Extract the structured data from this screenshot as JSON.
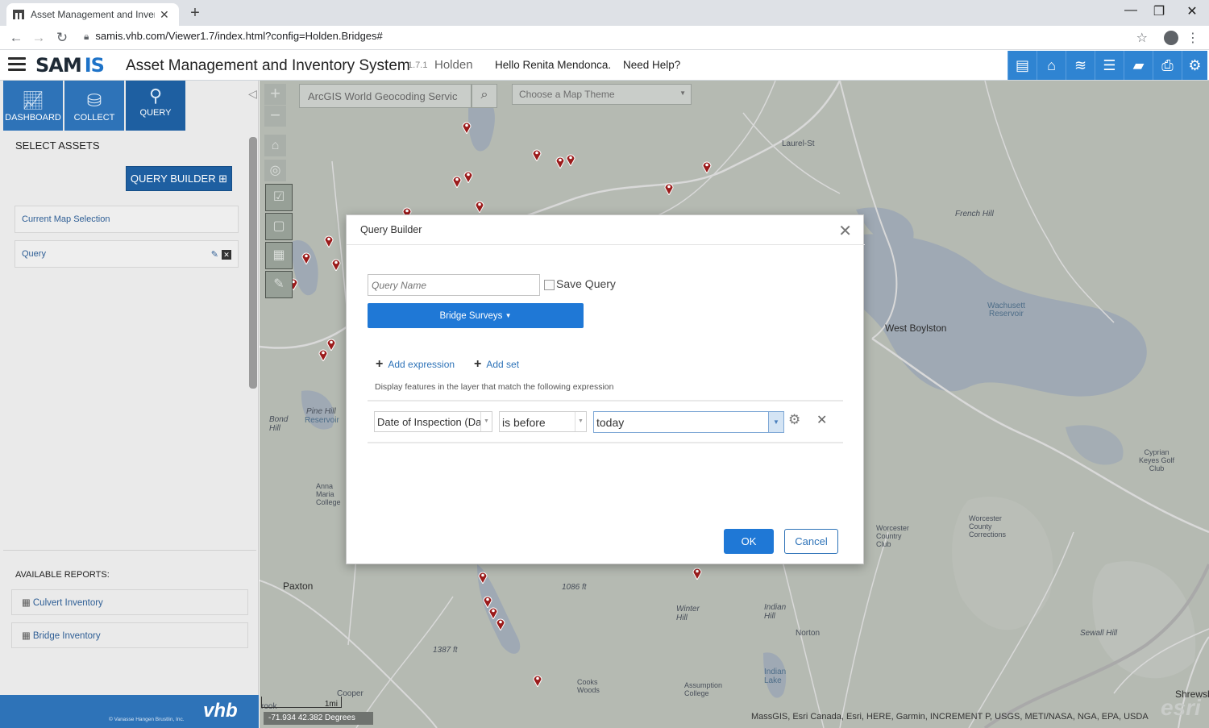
{
  "browser": {
    "tab_title": "Asset Management and Inventor",
    "new_tab_icon": "plus-icon",
    "url": "samis.vhb.com/Viewer1.7/index.html?config=Holden.Bridges#",
    "window_controls": [
      "minimize",
      "restore",
      "close"
    ]
  },
  "header": {
    "logo_sam": "SAM",
    "logo_is": "IS",
    "title": "Asset Management and Inventory System",
    "version": "1.7.1",
    "town": "Holden",
    "greeting": "Hello Renita Mendonca.",
    "help": "Need Help?",
    "toolbar_icons": [
      "report-icon",
      "home-icon",
      "layers-icon",
      "list-icon",
      "graduation-cap-icon",
      "print-icon",
      "gear-icon"
    ],
    "accent": "#2f84d2"
  },
  "left_panel": {
    "modes": [
      {
        "label": "DASHBOARD",
        "icon": "chart-icon"
      },
      {
        "label": "COLLECT",
        "icon": "database-icon"
      },
      {
        "label": "QUERY",
        "icon": "binoculars-icon"
      }
    ],
    "section_title": "SELECT ASSETS",
    "query_builder_button": "QUERY BUILDER",
    "items": [
      {
        "label": "Current Map Selection"
      },
      {
        "label": "Query"
      }
    ],
    "reports_title": "AVAILABLE REPORTS:",
    "reports": [
      {
        "label": "Culvert Inventory"
      },
      {
        "label": "Bridge Inventory"
      }
    ],
    "footer_copyright": "© Vanasse Hangen Brustlin, Inc.",
    "footer_logo": "vhb",
    "brand_color": "#2e73b8"
  },
  "map": {
    "search_placeholder": "ArcGIS World Geocoding Servic",
    "theme_placeholder": "Choose a Map Theme",
    "coordinates": "-71.934 42.382 Degrees",
    "scale_label": "1mi",
    "attribution": "MassGIS, Esri Canada, Esri, HERE, Garmin, INCREMENT P, USGS, METI/NASA, NGA, EPA, USDA",
    "esri_logo": "esri",
    "labels": {
      "west_boylston": "West Boylston",
      "wachusett": "Wachusett",
      "reservoir": "Reservoir",
      "paxton": "Paxton",
      "laurel_st": "Laurel-St",
      "french_hill": "French Hill",
      "bond_hill": "Bond Hill",
      "pine_hill": "Pine Hill",
      "pine_hill_res": "Reservoir",
      "anna_maria": "Anna Maria College",
      "worcester_cc": "Worcester Country Club",
      "worcester_county": "Worcester County Corrections",
      "assumption": "Assumption College",
      "cooks_woods": "Cooks Woods",
      "indian_lake": "Indian Lake",
      "indian_hill": "Indian Hill",
      "norton": "Norton",
      "winter_hill": "Winter Hill",
      "cyprian": "Cyprian Keyes Golf Club",
      "sewall_hill": "Sewall Hill",
      "shrewsbury": "Shrewsb",
      "elev_1086": "1086 ft",
      "elev_1387": "1387 ft",
      "cooper": "Cooper",
      "rook": "rook"
    }
  },
  "modal": {
    "title": "Query Builder",
    "query_name_placeholder": "Query Name",
    "save_query_label": "Save Query",
    "layer_button": "Bridge Surveys",
    "add_expression": "Add expression",
    "add_set": "Add set",
    "description": "Display features in the layer that match the following expression",
    "field": "Date of Inspection (Da",
    "operator": "is before",
    "value": "today",
    "ok": "OK",
    "cancel": "Cancel",
    "button_color": "#1f78d6"
  }
}
